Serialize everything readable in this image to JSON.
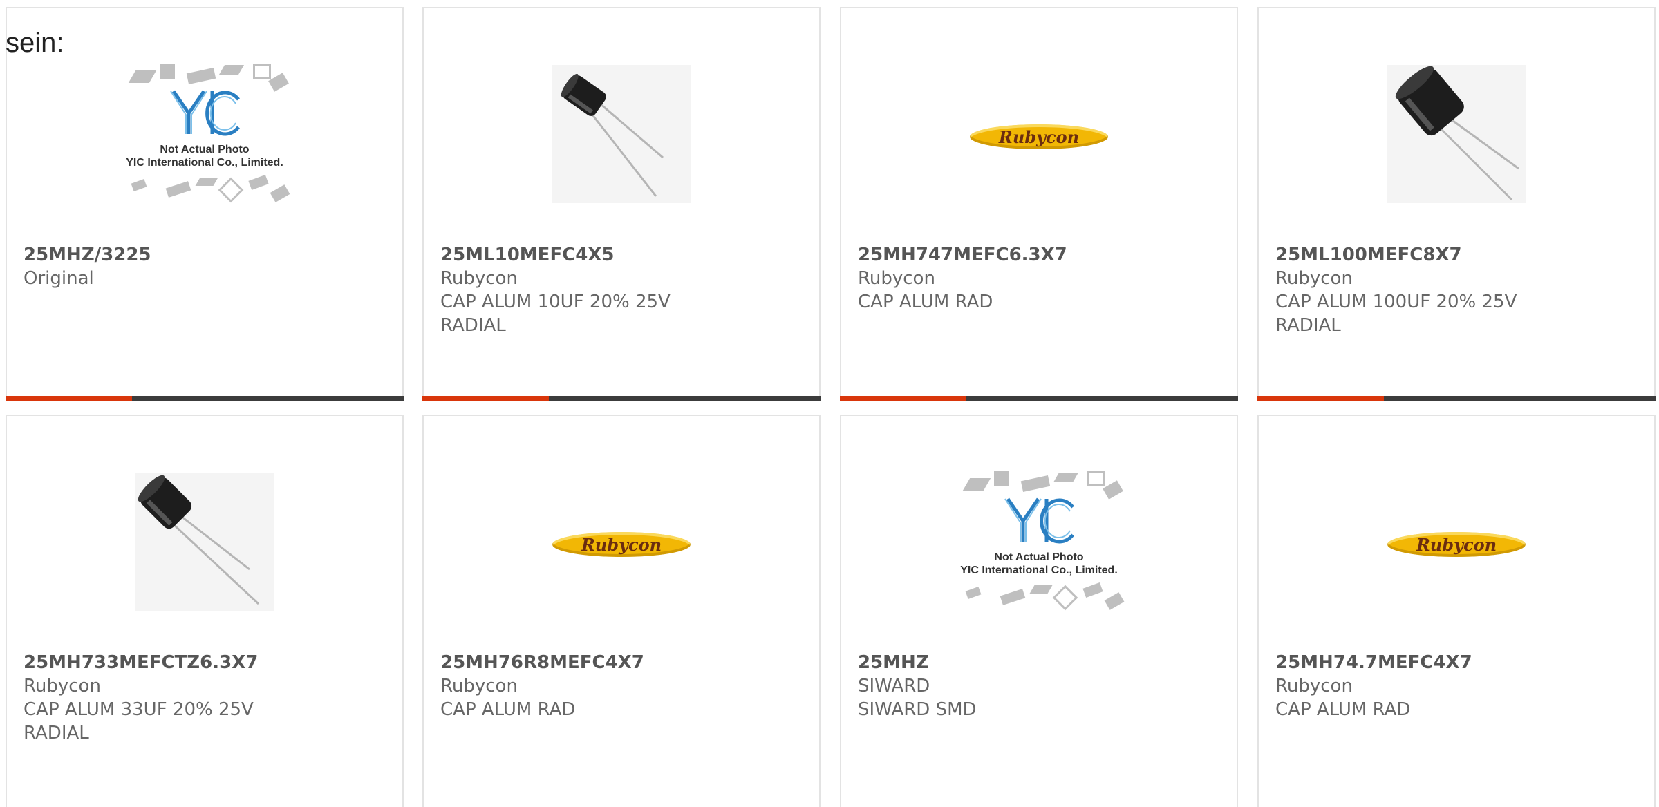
{
  "page": {
    "lead_text": "sein:"
  },
  "colors": {
    "accent": "#d9360b",
    "bar": "#3c3c3c",
    "border": "#e3e3e3",
    "brand_yellow": "#f2b705"
  },
  "placeholder": {
    "logo_text": "YIC",
    "line1": "Not Actual Photo",
    "line2": "YIC International Co., Limited."
  },
  "brand": {
    "name": "Rubycon"
  },
  "products": [
    {
      "part": "25MHZ/3225",
      "manufacturer": "Original",
      "description": "",
      "image": "placeholder"
    },
    {
      "part": "25ML10MEFC4X5",
      "manufacturer": "Rubycon",
      "description": "CAP ALUM 10UF 20% 25V RADIAL",
      "image": "photo-small"
    },
    {
      "part": "25MH747MEFC6.3X7",
      "manufacturer": "Rubycon",
      "description": "CAP ALUM RAD",
      "image": "brand-logo"
    },
    {
      "part": "25ML100MEFC8X7",
      "manufacturer": "Rubycon",
      "description": "CAP ALUM 100UF 20% 25V RADIAL",
      "image": "photo-large"
    },
    {
      "part": "25MH733MEFCTZ6.3X7",
      "manufacturer": "Rubycon",
      "description": "CAP ALUM 33UF 20% 25V RADIAL",
      "image": "photo-medium"
    },
    {
      "part": "25MH76R8MEFC4X7",
      "manufacturer": "Rubycon",
      "description": "CAP ALUM RAD",
      "image": "brand-logo"
    },
    {
      "part": "25MHZ",
      "manufacturer": "SIWARD",
      "description": "SIWARD SMD",
      "image": "placeholder"
    },
    {
      "part": "25MH74.7MEFC4X7",
      "manufacturer": "Rubycon",
      "description": "CAP ALUM RAD",
      "image": "brand-logo"
    }
  ]
}
